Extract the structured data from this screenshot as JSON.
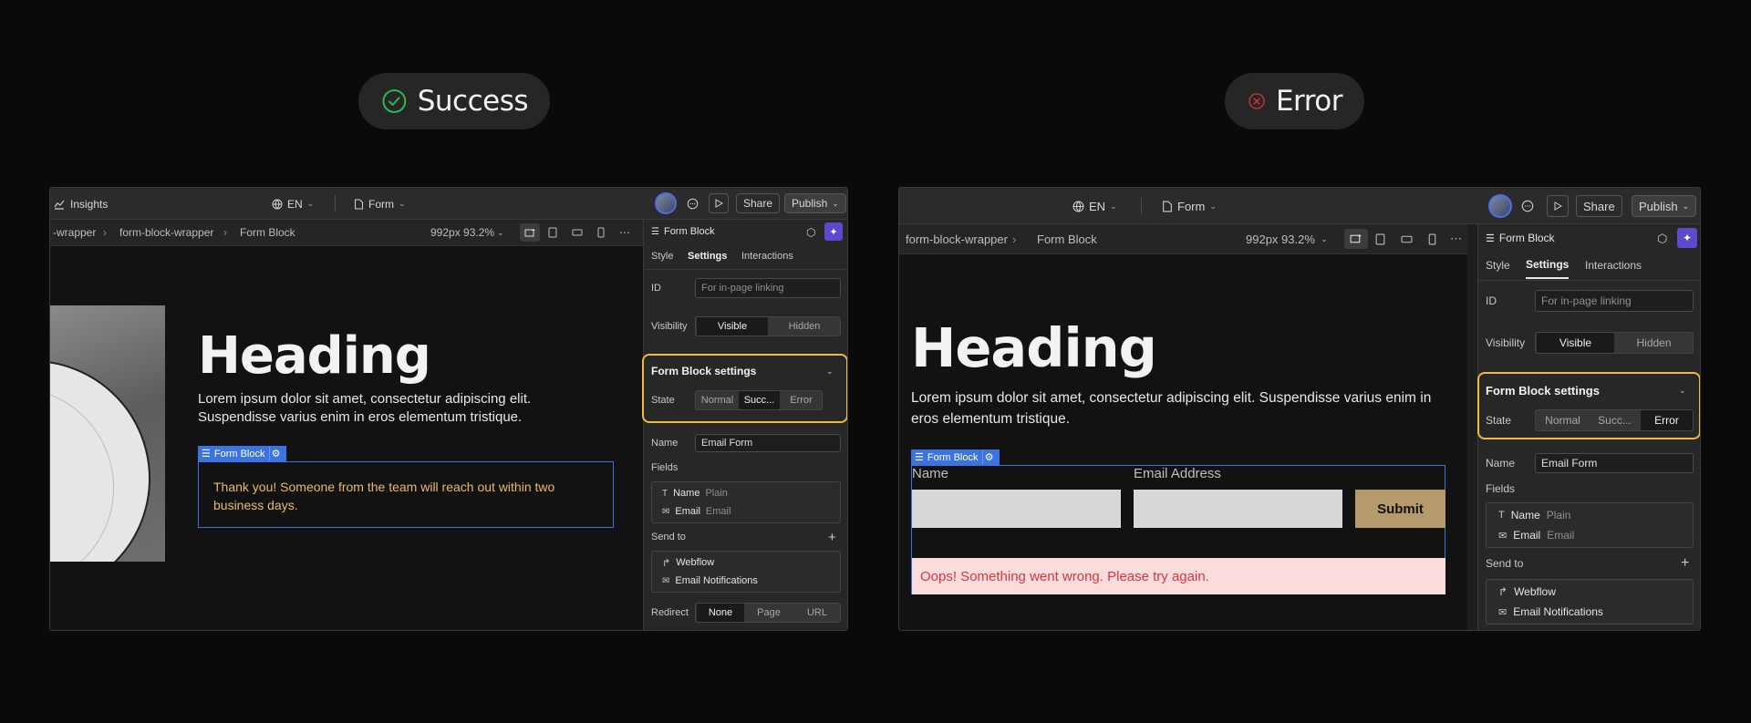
{
  "badges": {
    "success": "Success",
    "error": "Error"
  },
  "colors": {
    "accent": "#3b74e0",
    "highlight": "#f0b940",
    "success": "#2fbf4e",
    "error": "#e0313c",
    "success_text": "#e8b96b",
    "error_text": "#d9363e",
    "error_bg": "#fadcdc",
    "submit_bg": "#b59a6e"
  },
  "left": {
    "topbar": {
      "insights": "Insights",
      "lang": "EN",
      "page": "Form",
      "share": "Share",
      "publish": "Publish"
    },
    "breadcrumb": [
      "-wrapper",
      "form-block-wrapper",
      "Form Block"
    ],
    "viewport": "992px 93.2%",
    "canvas": {
      "heading": "Heading",
      "paragraph": "Lorem ipsum dolor sit amet, consectetur adipiscing elit. Suspendisse varius enim in eros elementum tristique.",
      "formtag": "Form Block",
      "message": "Thank you! Someone from the team will reach out within two business days."
    },
    "panel": {
      "title": "Form Block",
      "tabs": [
        "Style",
        "Settings",
        "Interactions"
      ],
      "id_label": "ID",
      "id_placeholder": "For in-page linking",
      "visibility_label": "Visibility",
      "visibility": [
        "Visible",
        "Hidden"
      ],
      "settings_title": "Form Block settings",
      "state_label": "State",
      "states": [
        "Normal",
        "Succ...",
        "Error"
      ],
      "name_label": "Name",
      "name_value": "Email Form",
      "fields_label": "Fields",
      "fields": [
        {
          "name": "Name",
          "type": "Plain"
        },
        {
          "name": "Email",
          "type": "Email"
        }
      ],
      "sendto_label": "Send to",
      "sendto": [
        "Webflow",
        "Email Notifications"
      ],
      "redirect_label": "Redirect",
      "redirect": [
        "None",
        "Page",
        "URL"
      ]
    }
  },
  "right": {
    "topbar": {
      "lang": "EN",
      "page": "Form",
      "share": "Share",
      "publish": "Publish"
    },
    "breadcrumb": [
      "form-block-wrapper",
      "Form Block"
    ],
    "viewport": "992px 93.2%",
    "canvas": {
      "heading": "Heading",
      "paragraph": "Lorem ipsum dolor sit amet, consectetur adipiscing elit. Suspendisse varius enim in eros elementum tristique.",
      "formtag": "Form Block",
      "field_name": "Name",
      "field_email": "Email Address",
      "submit": "Submit",
      "error_message": "Oops! Something went wrong. Please try again."
    },
    "panel": {
      "title": "Form Block",
      "tabs": [
        "Style",
        "Settings",
        "Interactions"
      ],
      "id_label": "ID",
      "id_placeholder": "For in-page linking",
      "visibility_label": "Visibility",
      "visibility": [
        "Visible",
        "Hidden"
      ],
      "settings_title": "Form Block settings",
      "state_label": "State",
      "states": [
        "Normal",
        "Succ...",
        "Error"
      ],
      "name_label": "Name",
      "name_value": "Email Form",
      "fields_label": "Fields",
      "fields": [
        {
          "name": "Name",
          "type": "Plain"
        },
        {
          "name": "Email",
          "type": "Email"
        }
      ],
      "sendto_label": "Send to",
      "sendto": [
        "Webflow",
        "Email Notifications"
      ]
    }
  }
}
